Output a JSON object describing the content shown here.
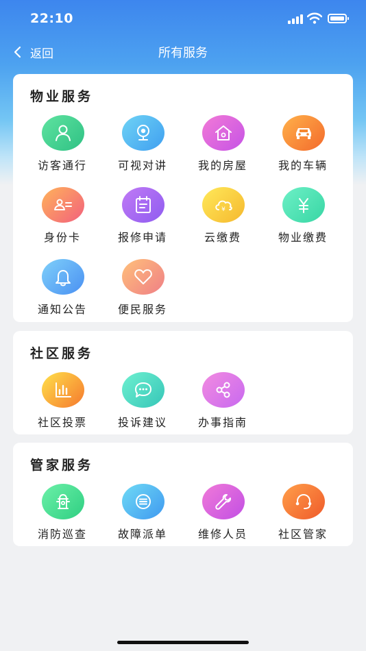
{
  "status_bar": {
    "time": "22:10"
  },
  "nav": {
    "back_label": "返回",
    "title": "所有服务"
  },
  "sections": [
    {
      "title": "物业服务",
      "items": [
        {
          "label": "访客通行",
          "icon": "visitor-icon"
        },
        {
          "label": "可视对讲",
          "icon": "camera-icon"
        },
        {
          "label": "我的房屋",
          "icon": "house-icon"
        },
        {
          "label": "我的车辆",
          "icon": "car-icon"
        },
        {
          "label": "身份卡",
          "icon": "id-card-icon"
        },
        {
          "label": "报修申请",
          "icon": "repair-form-icon"
        },
        {
          "label": "云缴费",
          "icon": "cloud-payment-icon"
        },
        {
          "label": "物业缴费",
          "icon": "yuan-icon"
        },
        {
          "label": "通知公告",
          "icon": "bell-icon"
        },
        {
          "label": "便民服务",
          "icon": "heart-icon"
        }
      ]
    },
    {
      "title": "社区服务",
      "items": [
        {
          "label": "社区投票",
          "icon": "bar-chart-icon"
        },
        {
          "label": "投诉建议",
          "icon": "chat-icon"
        },
        {
          "label": "办事指南",
          "icon": "share-icon"
        }
      ]
    },
    {
      "title": "管家服务",
      "items": [
        {
          "label": "消防巡查",
          "icon": "fire-hydrant-icon"
        },
        {
          "label": "故障派单",
          "icon": "list-icon"
        },
        {
          "label": "维修人员",
          "icon": "wrench-icon"
        },
        {
          "label": "社区管家",
          "icon": "headset-icon"
        }
      ]
    }
  ],
  "colors": {
    "header_gradient_top": "#3d86ee",
    "page_background": "#f0f1f3",
    "card_background": "#ffffff"
  }
}
